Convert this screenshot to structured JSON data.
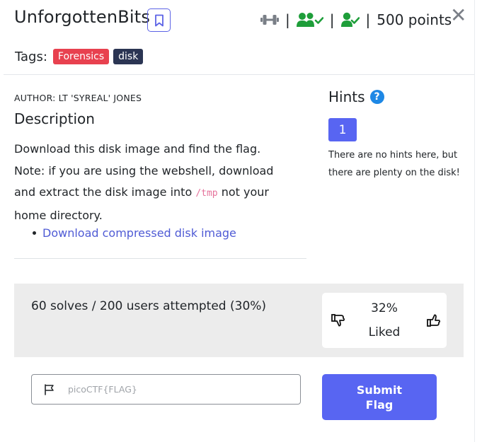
{
  "challenge": {
    "title": "UnforgottenBits",
    "points": "500 points",
    "separators": [
      "|",
      "|",
      "|"
    ]
  },
  "tags": {
    "label": "Tags:",
    "items": [
      "Forensics",
      "disk"
    ]
  },
  "author": "AUTHOR: LT 'SYREAL' JONES",
  "description": {
    "heading": "Description",
    "line1": "Download this disk image and find the flag.",
    "line2_pre": "Note: if you are using the webshell, download and extract the disk image into ",
    "line2_code": "/tmp",
    "line2_post": " not your home directory.",
    "link": "Download compressed disk image"
  },
  "hints": {
    "heading": "Hints",
    "help_icon": "?",
    "button": "1",
    "text": "There are no hints here, but there are plenty on the disk!"
  },
  "stats": {
    "solves": "60 solves / 200 users attempted (30%)",
    "liked_percent": "32%",
    "liked_label": "Liked"
  },
  "flag": {
    "placeholder": "picoCTF{FLAG}",
    "value": "",
    "submit": "Submit Flag"
  },
  "icons": {
    "bookmark": "bookmark-icon",
    "difficulty": "dumbbell-icon",
    "users": "users-check-icon",
    "user": "user-check-icon",
    "close": "close-icon",
    "thumbs_down": "thumbs-down-icon",
    "thumbs_up": "thumbs-up-icon",
    "flag": "flag-icon"
  },
  "colors": {
    "accent": "#5865f2",
    "tag_forensics": "#e8414f",
    "tag_disk": "#2b3553",
    "success": "#1e9e3a",
    "help": "#1e88e5"
  }
}
